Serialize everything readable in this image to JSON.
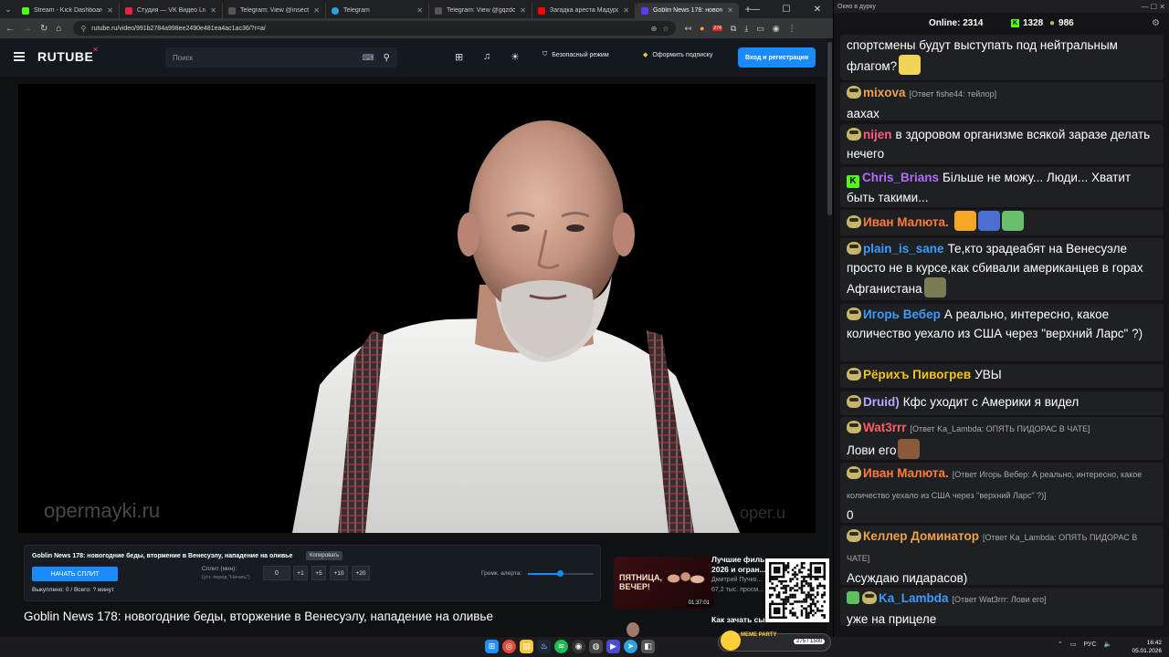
{
  "browser": {
    "tabs": [
      {
        "label": "Stream - Kick Dashboard",
        "color": "#53fc18",
        "active": false
      },
      {
        "label": "Студия — VK Видео Live",
        "color": "#e8233e",
        "active": false
      },
      {
        "label": "Telegram: View @insect_life",
        "color": "#3a3a3a",
        "active": false
      },
      {
        "label": "Telegram",
        "color": "#2aa3e0",
        "active": false
      },
      {
        "label": "Telegram: View @gqzdc",
        "color": "#3a3a3a",
        "active": false
      },
      {
        "label": "Загадка ареста Мадуро: в",
        "color": "#ff0000",
        "active": false
      },
      {
        "label": "Goblin News 178: новогод",
        "color": "#5e3bf0",
        "active": true
      }
    ],
    "url": "rutube.ru/video/991b2784a998ee2490e481ea4ac1ac36/?r=a/",
    "ext_badge": "274"
  },
  "rutube": {
    "logo": "RUTUBE",
    "search_placeholder": "Поиск",
    "safe_mode": "Безопасный режим",
    "subscribe": "Оформить подписку",
    "login": "Вход и регистрация"
  },
  "video": {
    "watermark": "opermayki.ru",
    "watermark2": "oper.u",
    "title": "Goblin News 178: новогодние беды, вторжение в Венесуэлу, нападение на оливье"
  },
  "split": {
    "title": "Goblin News 178: новогодние беды, вторжение в Венесуэлу, нападение на оливье",
    "copy": "Копировать",
    "start": "НАЧАТЬ СПЛИТ",
    "label": "Сплит (мин):",
    "sub": "(уст. перед \"Начать\")",
    "value": "0",
    "buttons": [
      "+1",
      "+5",
      "+10",
      "+20"
    ],
    "volume_label": "Громк. алерта:",
    "volume_level": 0.48,
    "status": "Выкуплено: 0 / Всего: ? минут"
  },
  "recommended": [
    {
      "title": "Лучшие филь...",
      "title2": "2026 и огран...",
      "author": "Дмитрий Пучко...",
      "views": "67,2 тыс. просм...",
      "duration": "01:37:01",
      "thumb_text": "ПЯТНИЦА, ВЕЧЕР!"
    },
    {
      "title": "Как зачать сы...",
      "title2": "",
      "author": "",
      "views": "",
      "duration": "",
      "thumb_text": ""
    }
  ],
  "chat": {
    "window_title": "Окно в дурку",
    "online_label": "Online:",
    "online": "2314",
    "kick_count": "1328",
    "goblin_count": "986",
    "messages": [
      {
        "name": "",
        "color": "#ffffff",
        "reply": "",
        "text": "спортсмены будут выступать под нейтральным флагом?",
        "badge": "none"
      },
      {
        "name": "mixova",
        "color": "#f0a14a",
        "reply": "[Ответ fishe44: тейлор]",
        "text": "аахах",
        "badge": "ava"
      },
      {
        "name": "nijen",
        "color": "#ff5e7e",
        "reply": "",
        "text": "в здоровом организме всякой заразе делать нечего",
        "badge": "ava"
      },
      {
        "name": "Chris_Brians",
        "color": "#b06cff",
        "reply": "",
        "text": "Більше не можу... Люди... Хватит быть такими...",
        "badge": "kick"
      },
      {
        "name": "Иван Малюта.",
        "color": "#ff7b3a",
        "reply": "",
        "text": "",
        "badge": "ava"
      },
      {
        "name": "plain_is_sane",
        "color": "#3a9cff",
        "reply": "",
        "text": "Те,кто зрадеабят на Венесуэле просто не в курсе,как сбивали американцев в горах Афганистана",
        "badge": "ava"
      },
      {
        "name": "Игорь Вебер",
        "color": "#3a9cff",
        "reply": "",
        "text": "А реально, интересно, какое количество уехало из США через \"верхний Ларс\" ?)",
        "badge": "ava"
      },
      {
        "name": "Рёрихъ Пивогрев",
        "color": "#f0c419",
        "reply": "",
        "text": "УВЫ",
        "badge": "ava"
      },
      {
        "name": "Druid)",
        "color": "#b9a6ff",
        "reply": "",
        "text": "Кфс уходит с Америки я видел",
        "badge": "ava"
      },
      {
        "name": "Wat3rrr",
        "color": "#ff5e5e",
        "reply": "[Ответ Ka_Lambda: ОПЯТЬ ПИДОРАС В ЧАТЕ]",
        "text": "Лови его",
        "badge": "ava"
      },
      {
        "name": "Иван Малюта.",
        "color": "#ff7b3a",
        "reply": "[Ответ Игорь Вебер: А реально, интересно, какое количество уехало из США через \"верхний Ларс\" ?)]",
        "text": "0",
        "badge": "ava"
      },
      {
        "name": "Келлер Доминатор",
        "color": "#f0a14a",
        "reply": "[Ответ Ka_Lambda: ОПЯТЬ ПИДОРАС В ЧАТЕ]",
        "text": "Асуждаю пидарасов)",
        "badge": "ava"
      },
      {
        "name": "Ka_Lambda",
        "color": "#3a9cff",
        "reply": "[Ответ Wat3rrr: Лови его]",
        "text": "уже на прицеле",
        "badge": "both"
      }
    ]
  },
  "taskbar": {
    "lang": "РУС",
    "time": "16:42",
    "date": "05.01.2026",
    "party_title": "MEME PARTY",
    "party_count": "275 / 1500"
  }
}
